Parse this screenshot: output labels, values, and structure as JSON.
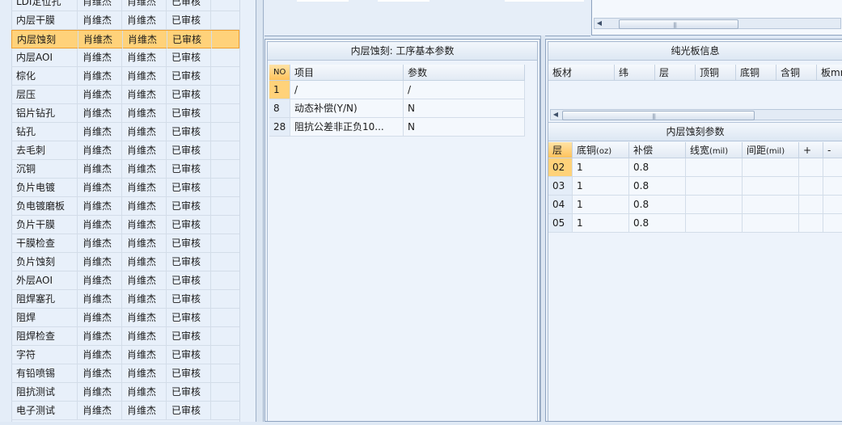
{
  "process_list": {
    "rows": [
      {
        "process": "LDI定位孔",
        "col2": "肖维杰",
        "col3": "肖维杰",
        "status": "已审核"
      },
      {
        "process": "内层干膜",
        "col2": "肖维杰",
        "col3": "肖维杰",
        "status": "已审核"
      },
      {
        "process": "内层蚀刻",
        "col2": "肖维杰",
        "col3": "肖维杰",
        "status": "已审核",
        "selected": true
      },
      {
        "process": "内层AOI",
        "col2": "肖维杰",
        "col3": "肖维杰",
        "status": "已审核"
      },
      {
        "process": "棕化",
        "col2": "肖维杰",
        "col3": "肖维杰",
        "status": "已审核"
      },
      {
        "process": "层压",
        "col2": "肖维杰",
        "col3": "肖维杰",
        "status": "已审核"
      },
      {
        "process": "铝片钻孔",
        "col2": "肖维杰",
        "col3": "肖维杰",
        "status": "已审核"
      },
      {
        "process": "钻孔",
        "col2": "肖维杰",
        "col3": "肖维杰",
        "status": "已审核"
      },
      {
        "process": "去毛刺",
        "col2": "肖维杰",
        "col3": "肖维杰",
        "status": "已审核"
      },
      {
        "process": "沉铜",
        "col2": "肖维杰",
        "col3": "肖维杰",
        "status": "已审核"
      },
      {
        "process": "负片电镀",
        "col2": "肖维杰",
        "col3": "肖维杰",
        "status": "已审核"
      },
      {
        "process": "负电镀磨板",
        "col2": "肖维杰",
        "col3": "肖维杰",
        "status": "已审核"
      },
      {
        "process": "负片干膜",
        "col2": "肖维杰",
        "col3": "肖维杰",
        "status": "已审核"
      },
      {
        "process": "干膜检查",
        "col2": "肖维杰",
        "col3": "肖维杰",
        "status": "已审核"
      },
      {
        "process": "负片蚀刻",
        "col2": "肖维杰",
        "col3": "肖维杰",
        "status": "已审核"
      },
      {
        "process": "外层AOI",
        "col2": "肖维杰",
        "col3": "肖维杰",
        "status": "已审核"
      },
      {
        "process": "阻焊塞孔",
        "col2": "肖维杰",
        "col3": "肖维杰",
        "status": "已审核"
      },
      {
        "process": "阻焊",
        "col2": "肖维杰",
        "col3": "肖维杰",
        "status": "已审核"
      },
      {
        "process": "阻焊检查",
        "col2": "肖维杰",
        "col3": "肖维杰",
        "status": "已审核"
      },
      {
        "process": "字符",
        "col2": "肖维杰",
        "col3": "肖维杰",
        "status": "已审核"
      },
      {
        "process": "有铅喷锡",
        "col2": "肖维杰",
        "col3": "肖维杰",
        "status": "已审核"
      },
      {
        "process": "阻抗测试",
        "col2": "肖维杰",
        "col3": "肖维杰",
        "status": "已审核"
      },
      {
        "process": "电子测试",
        "col2": "肖维杰",
        "col3": "肖维杰",
        "status": "已审核"
      }
    ]
  },
  "basic_params": {
    "title": "内层蚀刻: 工序基本参数",
    "headers": {
      "no": "NO",
      "item": "项目",
      "param": "参数"
    },
    "rows": [
      {
        "no": "1",
        "item": "/",
        "param": "/"
      },
      {
        "no": "8",
        "item": "动态补偿(Y/N)",
        "param": "N"
      },
      {
        "no": "28",
        "item": "阻抗公差非正负10...",
        "param": "N"
      }
    ]
  },
  "bare_board": {
    "title": "纯光板信息",
    "headers": [
      "板材",
      "纬",
      "层",
      "顶铜",
      "底铜",
      "含铜",
      "板mm"
    ]
  },
  "etch_params": {
    "title": "内层蚀刻参数",
    "headers": {
      "layer": "层",
      "bottom_cu": "底铜",
      "bottom_cu_unit": "(oz)",
      "comp": "补偿",
      "line_width": "线宽",
      "line_width_unit": "(mil)",
      "spacing": "间距",
      "spacing_unit": "(mil)",
      "plus": "+",
      "minus": "-"
    },
    "rows": [
      {
        "layer": "02",
        "bottom_cu": "1",
        "comp": "0.8"
      },
      {
        "layer": "03",
        "bottom_cu": "1",
        "comp": "0.8"
      },
      {
        "layer": "04",
        "bottom_cu": "1",
        "comp": "0.8"
      },
      {
        "layer": "05",
        "bottom_cu": "1",
        "comp": "0.8"
      }
    ]
  }
}
